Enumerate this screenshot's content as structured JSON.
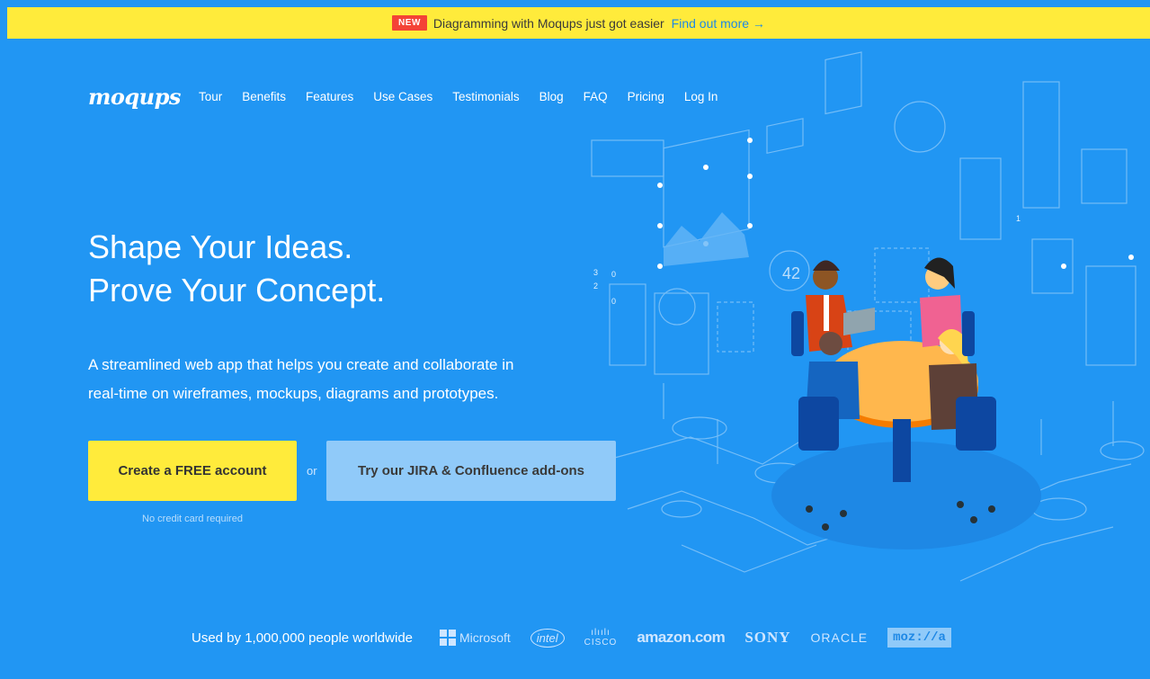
{
  "announcement": {
    "badge": "NEW",
    "text": "Diagramming with Moqups just got easier",
    "link": "Find out more →"
  },
  "nav": {
    "logo": "moqups",
    "items": [
      "Tour",
      "Benefits",
      "Features",
      "Use Cases",
      "Testimonials",
      "Blog",
      "FAQ",
      "Pricing",
      "Log In"
    ]
  },
  "hero": {
    "title_line1": "Shape Your Ideas.",
    "title_line2": "Prove Your Concept.",
    "subtitle_line1": "A streamlined web app that helps you create and collaborate in",
    "subtitle_line2": "real-time on wireframes, mockups, diagrams and prototypes.",
    "primary_cta": "Create a FREE account",
    "or": "or",
    "secondary_cta": "Try our JIRA & Confluence add-ons",
    "note": "No credit card required"
  },
  "illustration": {
    "counter": "42",
    "step1": "1",
    "step2": "2",
    "step3": "3",
    "step_o1": "0",
    "step_o2": "0"
  },
  "footer": {
    "used_by": "Used by 1,000,000 people worldwide",
    "brands": [
      "Microsoft",
      "intel",
      "CISCO",
      "amazon.com",
      "SONY",
      "ORACLE",
      "moz://a"
    ]
  },
  "colors": {
    "background": "#2196f3",
    "topbar": "#ffeb3b",
    "new_badge": "#f44336",
    "primary_button": "#ffeb3b",
    "secondary_button": "#90caf9",
    "link": "#1e88e5"
  }
}
